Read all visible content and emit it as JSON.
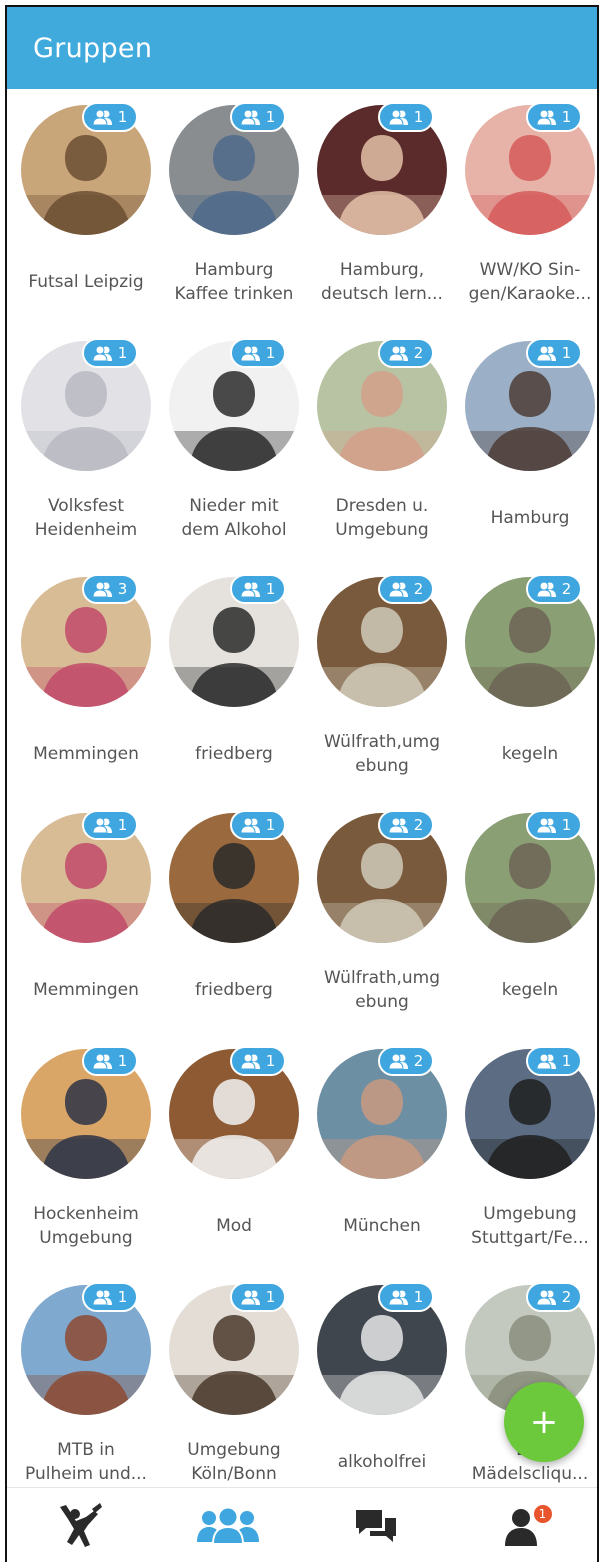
{
  "header": {
    "title": "Gruppen"
  },
  "colors": {
    "header": "#40aadc",
    "badge": "#3fa6df",
    "fab": "#6cc93b",
    "notification": "#e8552c"
  },
  "groups": [
    {
      "name": "Futsal Leipzig",
      "members": "1",
      "bg": "#c9a57a",
      "fg": "#6b4e33"
    },
    {
      "name": "Hamburg\nKaffee trinken",
      "members": "1",
      "bg": "#8a8d90",
      "fg": "#4d6a8a"
    },
    {
      "name": "Hamburg,\ndeutsch lern...",
      "members": "1",
      "bg": "#5b2b2c",
      "fg": "#e3c1a8"
    },
    {
      "name": "WW/KO Sin-\ngen/Karaoke...",
      "members": "1",
      "bg": "#e7b2a8",
      "fg": "#d55a5a"
    },
    {
      "name": "Volksfest\nHeidenheim",
      "members": "1",
      "bg": "#e1e1e6",
      "fg": "#b9b9c2"
    },
    {
      "name": "Nieder mit\ndem Alkohol",
      "members": "1",
      "bg": "#f1f1f1",
      "fg": "#2b2b2b"
    },
    {
      "name": "Dresden u.\nUmgebung",
      "members": "2",
      "bg": "#b7c3a3",
      "fg": "#d4a08b"
    },
    {
      "name": "Hamburg",
      "members": "1",
      "bg": "#9bb0c6",
      "fg": "#4d3d36"
    },
    {
      "name": "Memmingen",
      "members": "3",
      "bg": "#d7bc96",
      "fg": "#c24a6a"
    },
    {
      "name": "friedberg",
      "members": "1",
      "bg": "#e5e2dd",
      "fg": "#2a2a2a"
    },
    {
      "name": "Wülfrath,umg\nebung",
      "members": "2",
      "bg": "#7a5a3d",
      "fg": "#cfcab9"
    },
    {
      "name": "kegeln",
      "members": "2",
      "bg": "#8a9f74",
      "fg": "#6c6456"
    },
    {
      "name": "Memmingen",
      "members": "1",
      "bg": "#d7bc96",
      "fg": "#c24a6a"
    },
    {
      "name": "friedberg",
      "members": "1",
      "bg": "#9a6a3e",
      "fg": "#2a2a2a"
    },
    {
      "name": "Wülfrath,umg\nebung",
      "members": "2",
      "bg": "#7a5a3d",
      "fg": "#cfcab9"
    },
    {
      "name": "kegeln",
      "members": "1",
      "bg": "#8a9f74",
      "fg": "#6c6456"
    },
    {
      "name": "Hockenheim\nUmgebung",
      "members": "1",
      "bg": "#d9a668",
      "fg": "#2d3447"
    },
    {
      "name": "Mod",
      "members": "1",
      "bg": "#8d5a34",
      "fg": "#f2f2f2"
    },
    {
      "name": "München",
      "members": "2",
      "bg": "#6d8fa4",
      "fg": "#c99a80"
    },
    {
      "name": "Umgebung\nStuttgart/Fe...",
      "members": "1",
      "bg": "#5b6c83",
      "fg": "#202020"
    },
    {
      "name": "MTB in\nPulheim und...",
      "members": "1",
      "bg": "#7fa9cf",
      "fg": "#8d4a32"
    },
    {
      "name": "Umgebung\nKöln/Bonn",
      "members": "1",
      "bg": "#e3ddd5",
      "fg": "#4a3a2c"
    },
    {
      "name": "alkoholfrei",
      "members": "1",
      "bg": "#3f464e",
      "fg": "#e6e6e6"
    },
    {
      "name": "B...\nMädelscliqu...",
      "members": "2",
      "bg": "#c4c9bf",
      "fg": "#8a8e7c"
    }
  ],
  "fab": {
    "label": "+"
  },
  "tabs": [
    {
      "icon": "dancer-icon",
      "active": false
    },
    {
      "icon": "groups-icon",
      "active": true
    },
    {
      "icon": "chat-icon",
      "active": false
    },
    {
      "icon": "profile-icon",
      "active": false,
      "notification": "1"
    }
  ]
}
